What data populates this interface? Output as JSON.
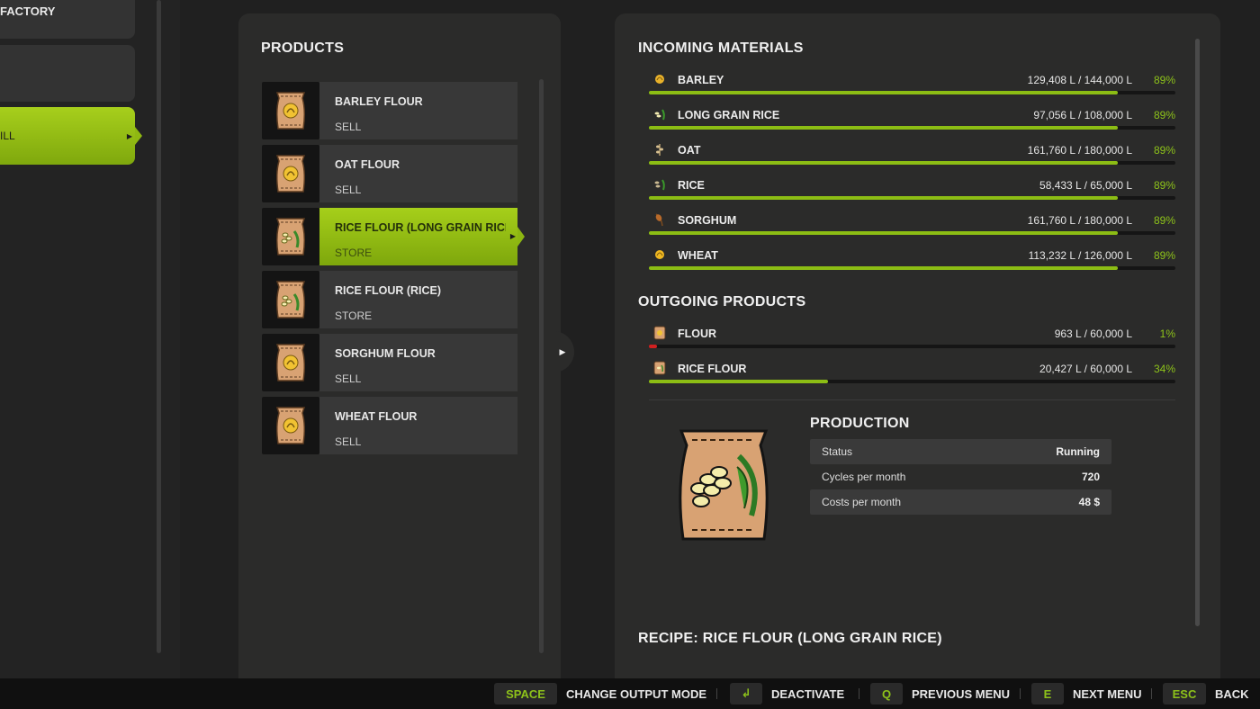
{
  "sidebar": {
    "items": [
      {
        "label": "FACTORY"
      },
      {
        "label": ""
      },
      {
        "label": "ILL"
      }
    ]
  },
  "products": {
    "title": "PRODUCTS",
    "items": [
      {
        "name": "BARLEY FLOUR",
        "mode": "SELL",
        "icon": "grain-sack-icon"
      },
      {
        "name": "OAT FLOUR",
        "mode": "SELL",
        "icon": "grain-sack-icon"
      },
      {
        "name": "RICE FLOUR (LONG GRAIN RICE)",
        "mode": "STORE",
        "icon": "rice-sack-icon"
      },
      {
        "name": "RICE FLOUR (RICE)",
        "mode": "STORE",
        "icon": "rice-sack-icon"
      },
      {
        "name": "SORGHUM FLOUR",
        "mode": "SELL",
        "icon": "grain-sack-icon"
      },
      {
        "name": "WHEAT FLOUR",
        "mode": "SELL",
        "icon": "grain-sack-icon"
      }
    ]
  },
  "incoming": {
    "title": "INCOMING MATERIALS",
    "items": [
      {
        "name": "BARLEY",
        "amount": "129,408 L / 144,000 L",
        "pct": "89%",
        "fill": 89,
        "icon": "barley-icon"
      },
      {
        "name": "LONG GRAIN RICE",
        "amount": "97,056 L / 108,000 L",
        "pct": "89%",
        "fill": 89,
        "icon": "long-grain-rice-icon"
      },
      {
        "name": "OAT",
        "amount": "161,760 L / 180,000 L",
        "pct": "89%",
        "fill": 89,
        "icon": "oat-icon"
      },
      {
        "name": "RICE",
        "amount": "58,433 L / 65,000 L",
        "pct": "89%",
        "fill": 89,
        "icon": "rice-icon"
      },
      {
        "name": "SORGHUM",
        "amount": "161,760 L / 180,000 L",
        "pct": "89%",
        "fill": 89,
        "icon": "sorghum-icon"
      },
      {
        "name": "WHEAT",
        "amount": "113,232 L / 126,000 L",
        "pct": "89%",
        "fill": 89,
        "icon": "wheat-icon"
      }
    ]
  },
  "outgoing": {
    "title": "OUTGOING PRODUCTS",
    "items": [
      {
        "name": "FLOUR",
        "amount": "963 L / 60,000 L",
        "pct": "1%",
        "fill": 1,
        "icon": "flour-icon"
      },
      {
        "name": "RICE FLOUR",
        "amount": "20,427 L / 60,000 L",
        "pct": "34%",
        "fill": 34,
        "icon": "rice-flour-icon"
      }
    ]
  },
  "production": {
    "title": "PRODUCTION",
    "rows": [
      {
        "key": "Status",
        "value": "Running"
      },
      {
        "key": "Cycles per month",
        "value": "720"
      },
      {
        "key": "Costs per month",
        "value": "48 $"
      }
    ]
  },
  "recipe": {
    "title": "RECIPE: RICE FLOUR (LONG GRAIN RICE)"
  },
  "bottom_bar": {
    "hints": [
      {
        "key": "SPACE",
        "label": "CHANGE OUTPUT MODE"
      },
      {
        "key": "↲",
        "label": "DEACTIVATE"
      },
      {
        "key": "Q",
        "label": "PREVIOUS MENU"
      },
      {
        "key": "E",
        "label": "NEXT MENU"
      },
      {
        "key": "ESC",
        "label": "BACK"
      }
    ]
  },
  "colors": {
    "accent": "#8cbd14",
    "warning": "#d02020",
    "panel": "#2b2b2a"
  }
}
